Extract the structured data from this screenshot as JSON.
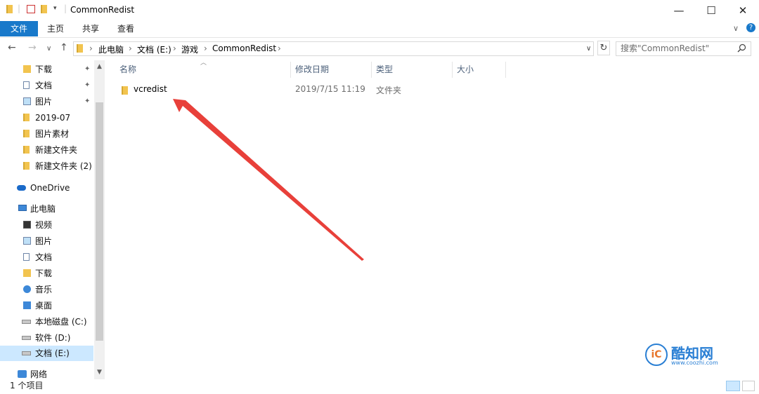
{
  "window": {
    "title": "CommonRedist",
    "minimize": "—",
    "maximize": "☐",
    "close": "✕"
  },
  "ribbon": {
    "tabs": [
      "文件",
      "主页",
      "共享",
      "查看"
    ],
    "expand": "∨",
    "help": "?"
  },
  "nav": {
    "back": "←",
    "forward": "→",
    "recent": "∨",
    "up": "↑"
  },
  "address": {
    "crumbs": [
      "此电脑",
      "文档 (E:)",
      "游戏",
      "CommonRedist"
    ],
    "separator": "›",
    "dropdown": "∨",
    "refresh": "↻"
  },
  "search": {
    "placeholder": "搜索\"CommonRedist\"",
    "icon": "search-icon"
  },
  "sidebar": {
    "quick_access": [
      {
        "label": "下载",
        "icon": "download",
        "pinned": true
      },
      {
        "label": "文档",
        "icon": "doc",
        "pinned": true
      },
      {
        "label": "图片",
        "icon": "pic",
        "pinned": true
      },
      {
        "label": "2019-07",
        "icon": "folder",
        "pinned": false
      },
      {
        "label": "图片素材",
        "icon": "folder",
        "pinned": false
      },
      {
        "label": "新建文件夹",
        "icon": "folder",
        "pinned": false
      },
      {
        "label": "新建文件夹 (2)",
        "icon": "folder",
        "pinned": false
      }
    ],
    "onedrive": "OneDrive",
    "this_pc": "此电脑",
    "pc_items": [
      {
        "label": "视频",
        "icon": "video"
      },
      {
        "label": "图片",
        "icon": "pic"
      },
      {
        "label": "文档",
        "icon": "doc"
      },
      {
        "label": "下载",
        "icon": "download"
      },
      {
        "label": "音乐",
        "icon": "music"
      },
      {
        "label": "桌面",
        "icon": "desk"
      },
      {
        "label": "本地磁盘 (C:)",
        "icon": "drive"
      },
      {
        "label": "软件 (D:)",
        "icon": "drive"
      },
      {
        "label": "文档 (E:)",
        "icon": "drive",
        "selected": true
      }
    ],
    "network": "网络",
    "pin_glyph": "📌"
  },
  "columns": {
    "name": "名称",
    "modified": "修改日期",
    "type": "类型",
    "size": "大小"
  },
  "files": [
    {
      "name": "vcredist",
      "modified": "2019/7/15 11:19",
      "type": "文件夹",
      "size": ""
    }
  ],
  "status": {
    "count": "1 个项目"
  },
  "watermark": {
    "logo_text": "酷知网",
    "url": "www.coozhi.com",
    "mark": "iC"
  },
  "colors": {
    "file_tab": "#1979ca",
    "selection": "#cce8ff",
    "arrow": "#e8403a"
  }
}
